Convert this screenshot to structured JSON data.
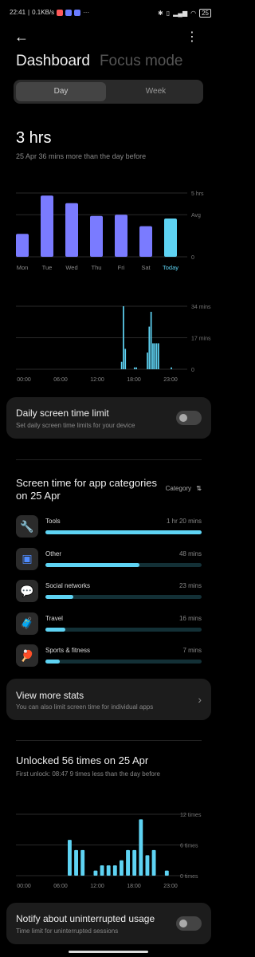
{
  "status_bar": {
    "time": "22:41",
    "speed": "0.1KB/s",
    "dots": "···",
    "battery": "25"
  },
  "header": {
    "tab_dashboard": "Dashboard",
    "tab_focus": "Focus mode"
  },
  "segmented": {
    "day": "Day",
    "week": "Week"
  },
  "summary": {
    "total": "3 hrs",
    "comparison": "25 Apr  36 mins more than the day before"
  },
  "weekly_chart": {
    "type": "bar",
    "categories": [
      "Mon",
      "Tue",
      "Wed",
      "Thu",
      "Fri",
      "Sat",
      "Today"
    ],
    "values_hrs": [
      1.8,
      4.8,
      4.2,
      3.2,
      3.3,
      2.4,
      3.0
    ],
    "ylabels": {
      "max": "5 hrs",
      "avg": "Avg",
      "zero": "0"
    },
    "ymax": 5,
    "avg": 3.3,
    "bar_color": "#7a7bff",
    "today_color": "#5ed3f3"
  },
  "hourly_chart": {
    "type": "bar",
    "xlabels": [
      "00:00",
      "06:00",
      "12:00",
      "18:00",
      "23:00"
    ],
    "ylabels": [
      "34 mins",
      "17 mins",
      "0"
    ],
    "ymax": 34,
    "values": [
      0,
      0,
      0,
      0,
      0,
      0,
      0,
      0,
      0,
      0,
      0,
      0,
      0,
      0,
      0,
      0,
      0,
      0,
      0,
      0,
      0,
      0,
      0,
      0,
      0,
      0,
      0,
      0,
      0,
      0,
      0,
      0,
      0,
      0,
      0,
      0,
      0,
      0,
      0,
      0,
      0,
      0,
      0,
      0,
      0,
      0,
      0,
      0,
      0,
      0,
      0,
      0,
      0,
      0,
      0,
      0,
      0,
      4,
      34,
      11,
      0,
      0,
      0,
      0,
      1,
      1,
      0,
      0,
      0,
      0,
      0,
      9,
      23,
      31,
      14,
      14,
      14,
      14,
      0,
      0,
      0,
      0,
      0,
      0,
      1,
      0,
      0,
      0,
      0,
      0,
      0,
      0,
      0
    ],
    "color": "#5ed3f3"
  },
  "limit_card": {
    "title": "Daily screen time limit",
    "subtitle": "Set daily screen time limits for your device"
  },
  "categories": {
    "title": "Screen time for app categories on 25 Apr",
    "sort_label": "Category",
    "items": [
      {
        "name": "Tools",
        "time": "1 hr 20 mins",
        "fraction": 1.0,
        "icon": "wrench-icon"
      },
      {
        "name": "Other",
        "time": "48 mins",
        "fraction": 0.6,
        "icon": "apps-icon"
      },
      {
        "name": "Social networks",
        "time": "23 mins",
        "fraction": 0.18,
        "icon": "chat-icon"
      },
      {
        "name": "Travel",
        "time": "16 mins",
        "fraction": 0.13,
        "icon": "suitcase-icon"
      },
      {
        "name": "Sports & fitness",
        "time": "7 mins",
        "fraction": 0.09,
        "icon": "pingpong-icon"
      }
    ]
  },
  "more_stats": {
    "title": "View more stats",
    "subtitle": "You can also limit screen time for individual apps"
  },
  "unlocks": {
    "title": "Unlocked 56 times on 25 Apr",
    "subtitle": "First unlock: 08:47   9 times less than the day before",
    "xlabels": [
      "00:00",
      "06:00",
      "12:00",
      "18:00",
      "23:00"
    ],
    "ylabels": [
      "12 times",
      "6 times",
      "0 times"
    ],
    "ymax": 12,
    "values": [
      0,
      0,
      0,
      0,
      0,
      0,
      0,
      0,
      7,
      5,
      5,
      0,
      1,
      2,
      2,
      2,
      3,
      5,
      5,
      11,
      4,
      5,
      0,
      1
    ],
    "color": "#5ed3f3"
  },
  "uninterrupted": {
    "title": "Notify about uninterrupted usage",
    "subtitle": "Time limit for uninterrupted sessions"
  }
}
